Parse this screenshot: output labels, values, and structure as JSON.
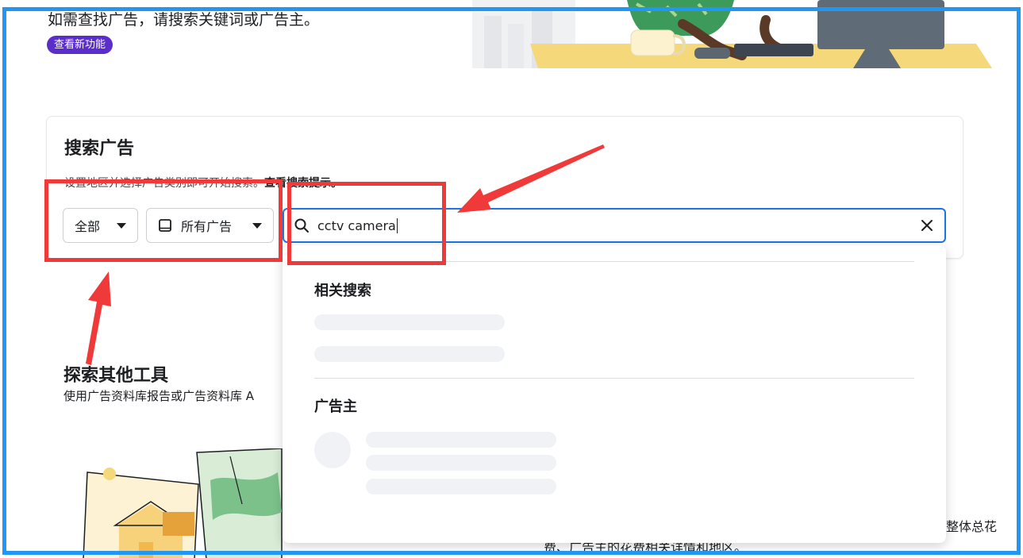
{
  "header": {
    "intro": "如需查找广告，请搜索关键词或广告主。",
    "new_feature_badge": "查看新功能"
  },
  "search_card": {
    "title": "搜索广告",
    "hint_prefix": "设置地区并选择广告类别即可开始搜索。",
    "hint_link": "查看搜索提示。",
    "region_dropdown": "全部",
    "ad_type_dropdown": "所有广告",
    "search_value": "cctv camera"
  },
  "suggestions": {
    "related_heading": "相关搜索",
    "advertisers_heading": "广告主"
  },
  "explore": {
    "title": "探索其他工具",
    "description": "使用广告资料库报告或广告资料库 A"
  },
  "background_text": {
    "right_fragment": "整体总花",
    "bottom_fragment": "费、广告主的花费相关详情和地区。"
  },
  "colors": {
    "annotation": "#f03a3a",
    "frame_border": "#2196f3",
    "search_focus": "#1b74e4",
    "badge": "#5b2ecc"
  },
  "icons": [
    "tablet-icon",
    "search-icon",
    "close-icon",
    "caret-down-icon"
  ]
}
